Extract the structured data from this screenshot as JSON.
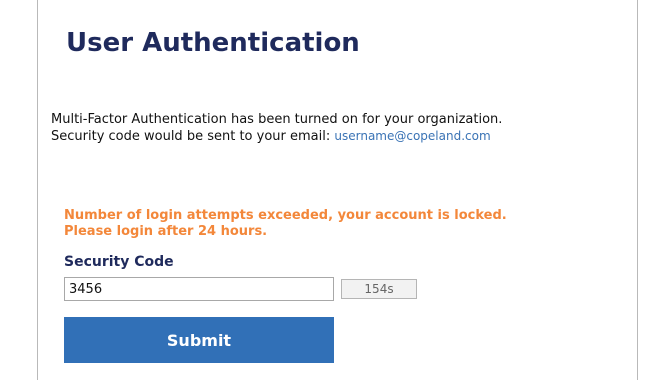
{
  "page": {
    "title": "User Authentication"
  },
  "info": {
    "line1": "Multi-Factor Authentication has been turned on for your organization.",
    "line2_prefix": "Security code would be sent to your email:",
    "email": "username@copeland.com"
  },
  "error": {
    "line1": "Number of login attempts exceeded, your account is locked.",
    "line2": "Please login after 24 hours."
  },
  "form": {
    "code_label": "Security Code",
    "code_value": "3456",
    "timer_label": "154s",
    "submit_label": "Submit"
  },
  "colors": {
    "title": "#1f2a5c",
    "email_link": "#3a73b5",
    "error": "#f3873a",
    "button": "#3170b7"
  }
}
